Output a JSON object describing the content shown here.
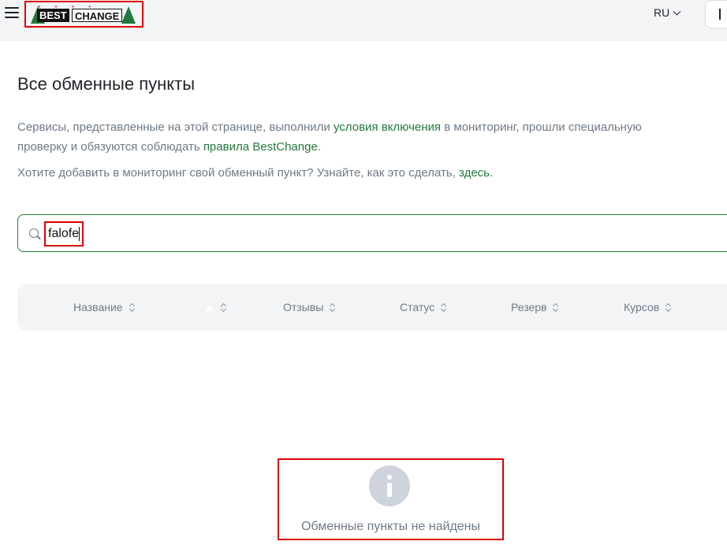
{
  "header": {
    "logo_best": "BEST",
    "logo_change": "CHANGE",
    "language": "RU"
  },
  "page": {
    "title": "Все обменные пункты",
    "desc_part1": "Сервисы, представленные на этой странице, выполнили ",
    "desc_link1": "условия включения",
    "desc_part2": " в мониторинг, прошли специальную",
    "desc_part3": "проверку и обязуются соблюдать ",
    "desc_link2": "правила BestChange",
    "desc_part4": ".",
    "add_text": "Хотите добавить в мониторинг свой обменный пункт? Узнайте, как это сделать, ",
    "add_link": "здесь."
  },
  "search": {
    "value": "falofe"
  },
  "table": {
    "columns": [
      "Название",
      "",
      "Отзывы",
      "Статус",
      "Резерв",
      "Курсов"
    ]
  },
  "empty": {
    "message": "Обменные пункты не найдены"
  },
  "colors": {
    "accent": "#23783c",
    "highlight": "#e00000"
  }
}
